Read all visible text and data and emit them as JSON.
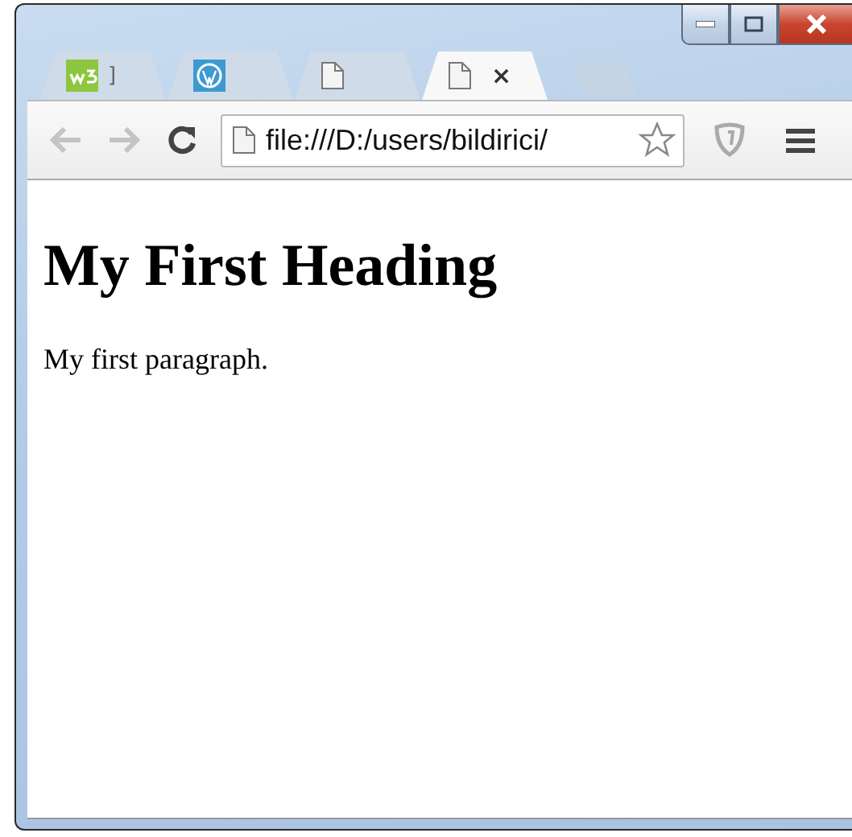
{
  "tabs": [
    {
      "kind": "w3",
      "label": "]",
      "selected": false
    },
    {
      "kind": "wordpress",
      "selected": false
    },
    {
      "kind": "page",
      "selected": false
    },
    {
      "kind": "page",
      "selected": true,
      "close": "×"
    }
  ],
  "toolbar": {
    "back_disabled": true,
    "forward_disabled": true,
    "address": "file:///D:/users/bildirici/"
  },
  "page": {
    "heading": "My First Heading",
    "paragraph": "My first paragraph."
  }
}
